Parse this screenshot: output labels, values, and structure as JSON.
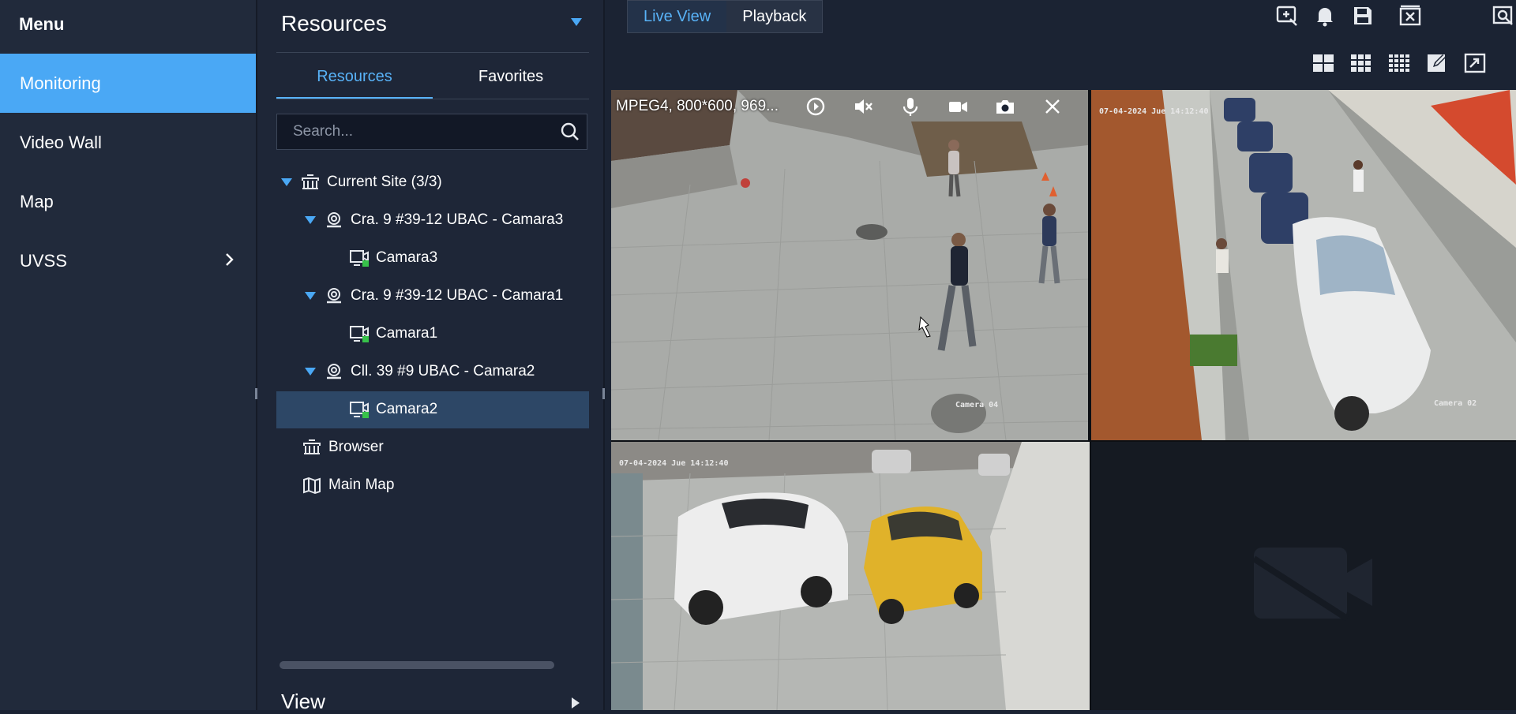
{
  "menu": {
    "title": "Menu",
    "items": [
      {
        "label": "Monitoring",
        "active": true
      },
      {
        "label": "Video Wall"
      },
      {
        "label": "Map"
      },
      {
        "label": "UVSS",
        "has_submenu": true
      }
    ]
  },
  "resources": {
    "header": "Resources",
    "tabs": [
      {
        "label": "Resources",
        "active": true
      },
      {
        "label": "Favorites"
      }
    ],
    "search_placeholder": "Search...",
    "tree": [
      {
        "label": "Current Site (3/3)",
        "icon": "site-icon"
      },
      {
        "label": "Cra. 9 #39-12 UBAC - Camara3",
        "icon": "device-icon"
      },
      {
        "label": "Camara3",
        "icon": "camera-channel-icon"
      },
      {
        "label": "Cra. 9 #39-12  UBAC - Camara1",
        "icon": "device-icon"
      },
      {
        "label": "Camara1",
        "icon": "camera-channel-icon"
      },
      {
        "label": "Cll. 39 #9  UBAC - Camara2",
        "icon": "device-icon"
      },
      {
        "label": "Camara2",
        "icon": "camera-channel-icon",
        "selected": true
      },
      {
        "label": "Browser",
        "icon": "site-icon"
      },
      {
        "label": "Main Map",
        "icon": "map-icon"
      }
    ],
    "view_label": "View"
  },
  "main": {
    "mode_tabs": [
      {
        "label": "Live View",
        "active": true
      },
      {
        "label": "Playback"
      }
    ],
    "toolbar_icons": [
      "add-window-icon",
      "alarm-bell-icon",
      "save-view-icon",
      "close-all-icon",
      "search-playback-icon"
    ],
    "layout_icons": [
      "layout-4-icon",
      "layout-9-icon",
      "layout-16-icon",
      "custom-layout-icon",
      "fullscreen-icon"
    ],
    "video_overlay": {
      "info": "MPEG4, 800*600, 969...",
      "icons": [
        "playback-icon",
        "mute-icon",
        "microphone-icon",
        "record-icon",
        "snapshot-icon",
        "close-icon"
      ]
    },
    "cells": [
      {
        "camera_label": "Camera 04",
        "timestamp": ""
      },
      {
        "camera_label": "Camera 02",
        "timestamp": "07-04-2024 Jue 14:12:40"
      },
      {
        "camera_label": "",
        "timestamp": "07-04-2024 Jue 14:12:40"
      },
      {
        "camera_label": "",
        "timestamp": "",
        "empty": true
      }
    ]
  },
  "colors": {
    "accent": "#4aa8f5",
    "selected_row": "#2d4766",
    "panel": "#1e2637"
  }
}
